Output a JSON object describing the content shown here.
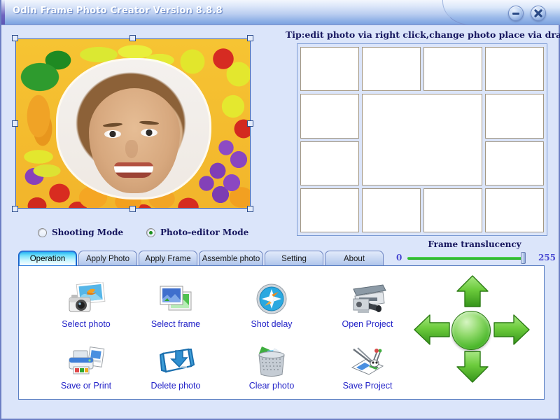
{
  "window": {
    "title": "Odin Frame Photo Creator Version 8.8.8",
    "minimize_icon": "minimize-icon",
    "close_icon": "close-icon"
  },
  "tip": {
    "text": "Tip:edit photo via right click,change photo place via drag it"
  },
  "modes": {
    "items": [
      {
        "label": "Shooting Mode",
        "selected": false
      },
      {
        "label": "Photo-editor Mode",
        "selected": true
      }
    ]
  },
  "translucency": {
    "label": "Frame translucency",
    "min": "0",
    "max": "255",
    "value": 255
  },
  "tabs": [
    {
      "label": "Operation",
      "active": true
    },
    {
      "label": "Apply Photo",
      "active": false
    },
    {
      "label": "Apply Frame",
      "active": false
    },
    {
      "label": "Assemble photo",
      "active": false
    },
    {
      "label": "Setting",
      "active": false
    },
    {
      "label": "About",
      "active": false
    }
  ],
  "operations": [
    {
      "label": "Select photo",
      "icon": "camera-photo-icon"
    },
    {
      "label": "Select frame",
      "icon": "picture-frames-icon"
    },
    {
      "label": "Shot delay",
      "icon": "compass-clock-icon"
    },
    {
      "label": "Open Project",
      "icon": "scanner-open-icon"
    },
    {
      "label": "Save or Print",
      "icon": "printer-icon"
    },
    {
      "label": "Delete photo",
      "icon": "box-down-arrow-icon"
    },
    {
      "label": "Clear photo",
      "icon": "trash-bin-icon"
    },
    {
      "label": "Save Project",
      "icon": "pen-drafting-icon"
    }
  ],
  "dpad": {
    "up": "arrow-up-icon",
    "down": "arrow-down-icon",
    "left": "arrow-left-icon",
    "right": "arrow-right-icon",
    "center": "center-button"
  },
  "thumbnails": {
    "count": 13,
    "rows": 4,
    "cols": 4,
    "center_merged": true
  },
  "colors": {
    "window_background": "#dbe5fa",
    "panel_background": "#ffffff",
    "title_text": "#ffffff",
    "label_blue": "#2323c8",
    "heading_navy": "#16165e",
    "accent_cyan": "#1aa8f0",
    "slider_green": "#18a818",
    "arrow_green": "#4cb82c",
    "border_blue": "#5b7fc2"
  }
}
